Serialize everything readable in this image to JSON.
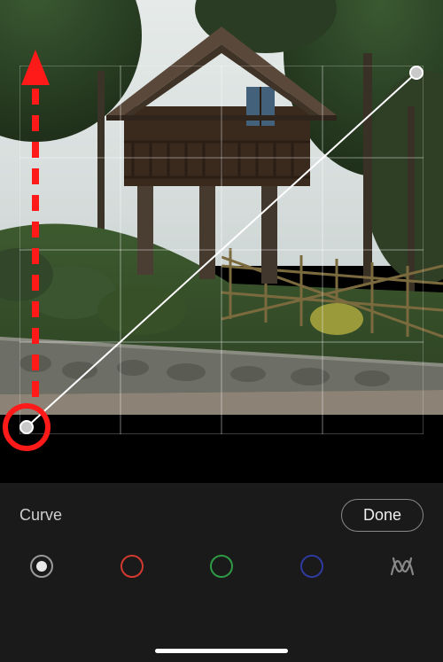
{
  "header": {
    "tool_label": "Curve",
    "done_label": "Done"
  },
  "channels": {
    "luma": "luma",
    "red": "red",
    "green": "green",
    "blue": "blue",
    "parametric": "parametric"
  },
  "annotation": {
    "hint": "drag-up"
  }
}
